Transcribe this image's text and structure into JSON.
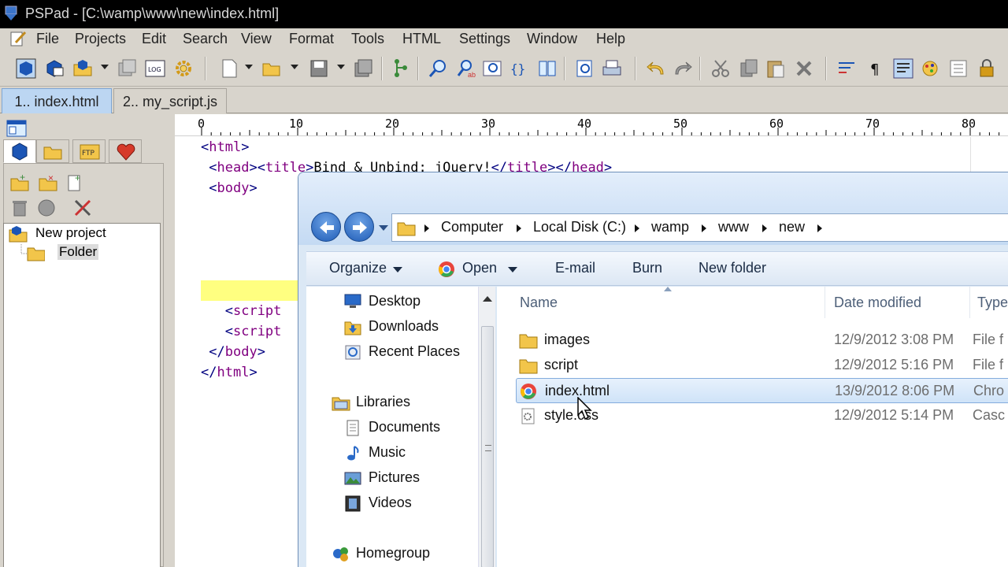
{
  "window": {
    "title": "PSPad - [C:\\wamp\\www\\new\\index.html]"
  },
  "menu": [
    "File",
    "Projects",
    "Edit",
    "Search",
    "View",
    "Format",
    "Tools",
    "HTML",
    "Settings",
    "Window",
    "Help"
  ],
  "tabs": [
    {
      "label": "1.. index.html",
      "active": true
    },
    {
      "label": "2.. my_script.js",
      "active": false
    }
  ],
  "project": {
    "tree": [
      {
        "label": "New project"
      },
      {
        "label": "Folder"
      }
    ]
  },
  "ruler": {
    "labels": [
      "0",
      "10",
      "20",
      "30",
      "40",
      "50",
      "60",
      "70",
      "80"
    ]
  },
  "editor": {
    "lines": [
      {
        "text": "<html>"
      },
      {
        "text": " <head><title>Bind & Unbind: jQuery!</title></head>"
      },
      {
        "text": " <body>"
      },
      {
        "text": ""
      },
      {
        "text": ""
      },
      {
        "text": ""
      },
      {
        "text": ""
      },
      {
        "text": ""
      },
      {
        "text": "   <script"
      },
      {
        "text": "   <script"
      },
      {
        "text": " </body>"
      },
      {
        "text": "</html>"
      }
    ]
  },
  "explorer": {
    "breadcrumb": [
      "Computer",
      "Local Disk (C:)",
      "wamp",
      "www",
      "new"
    ],
    "commands": {
      "organize": "Organize",
      "open": "Open",
      "email": "E-mail",
      "burn": "Burn",
      "new_folder": "New folder"
    },
    "nav": {
      "favorites": [
        "Desktop",
        "Downloads",
        "Recent Places"
      ],
      "libraries_label": "Libraries",
      "libraries": [
        "Documents",
        "Music",
        "Pictures",
        "Videos"
      ],
      "homegroup": "Homegroup"
    },
    "columns": {
      "name": "Name",
      "date": "Date modified",
      "type": "Type"
    },
    "files": [
      {
        "name": "images",
        "date": "12/9/2012 3:08 PM",
        "type": "File f",
        "icon": "folder-icon"
      },
      {
        "name": "script",
        "date": "12/9/2012 5:16 PM",
        "type": "File f",
        "icon": "folder-icon"
      },
      {
        "name": "index.html",
        "date": "13/9/2012 8:06 PM",
        "type": "Chro",
        "icon": "chrome-icon",
        "selected": true
      },
      {
        "name": "style.css",
        "date": "12/9/2012 5:14 PM",
        "type": "Casc",
        "icon": "css-file-icon"
      }
    ]
  },
  "colors": {
    "accent": "#bcd6f2",
    "highlight_line": "#ffff80",
    "tag": "#000080",
    "tag_name": "#800080"
  }
}
